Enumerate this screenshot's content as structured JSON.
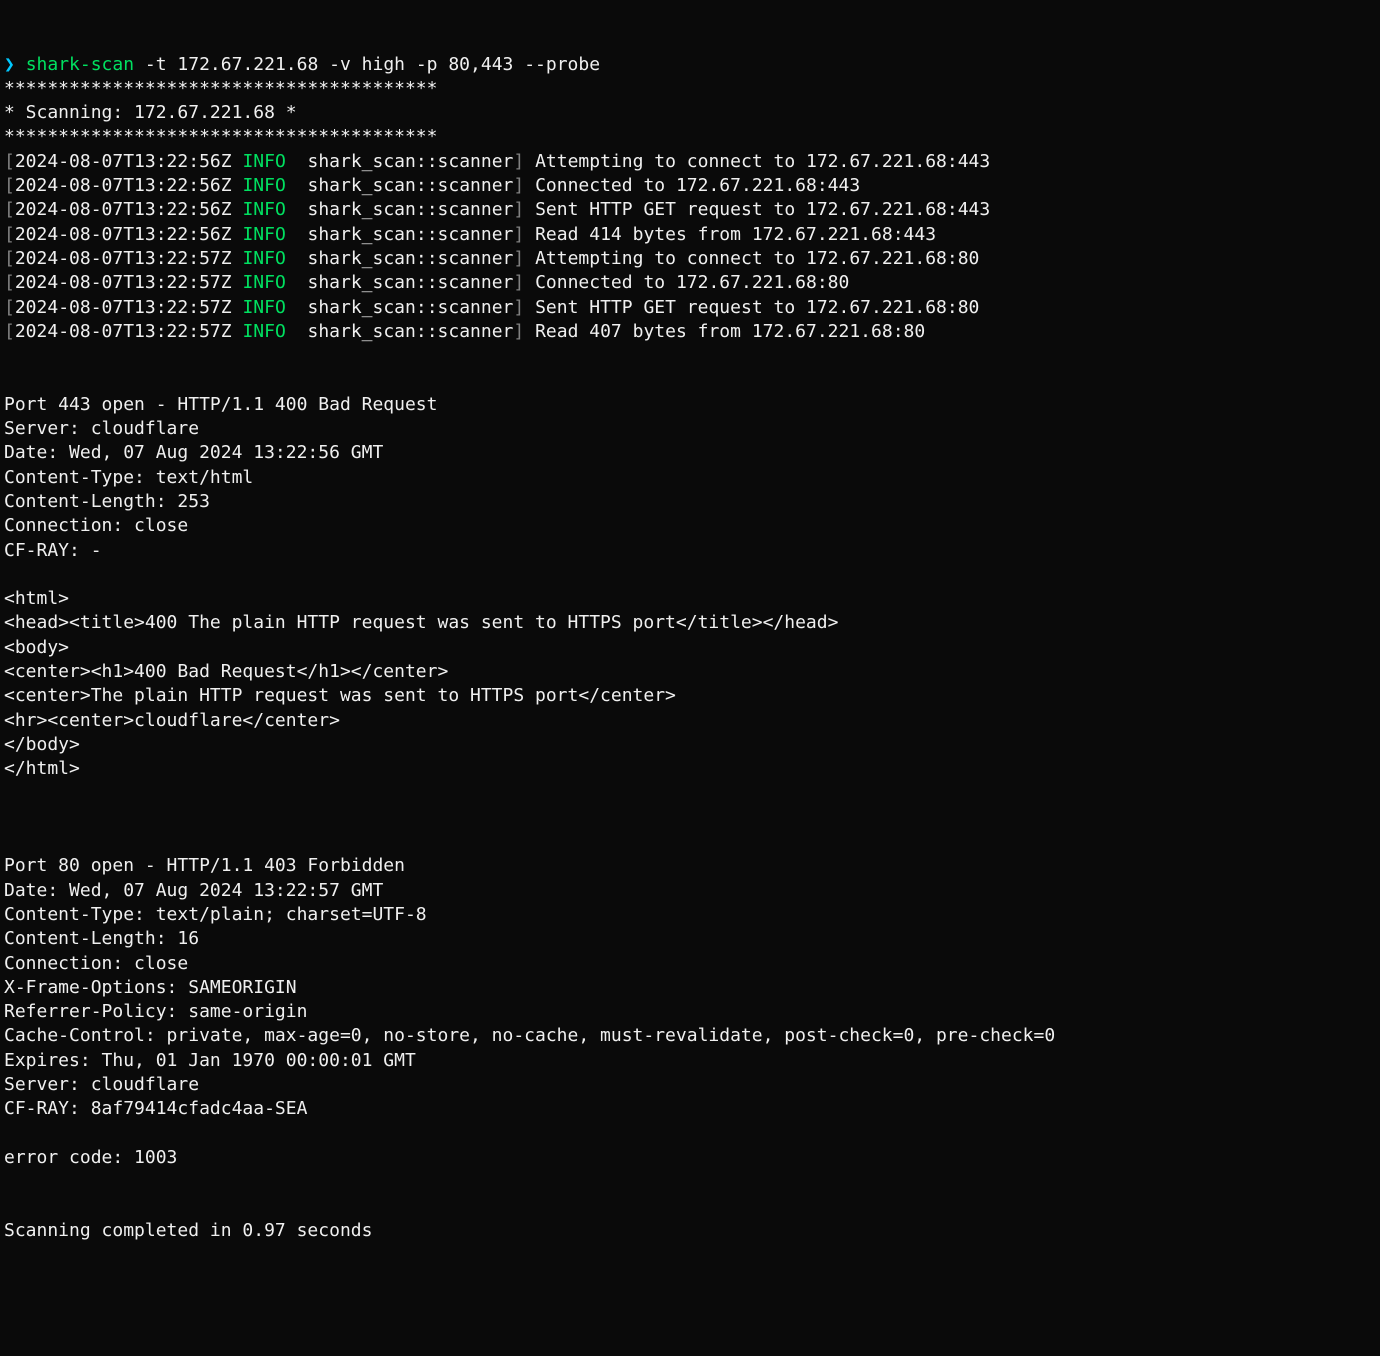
{
  "prompt": {
    "indicator": "❯",
    "cmd": "shark-scan",
    "args": "-t 172.67.221.68 -v high -p 80,443 --probe"
  },
  "banner": {
    "border": "****************************************",
    "title": "* Scanning: 172.67.221.68 *"
  },
  "logs": [
    {
      "ts": "2024-08-07T13:22:56Z",
      "level": "INFO",
      "module": "shark_scan::scanner",
      "msg": "Attempting to connect to 172.67.221.68:443"
    },
    {
      "ts": "2024-08-07T13:22:56Z",
      "level": "INFO",
      "module": "shark_scan::scanner",
      "msg": "Connected to 172.67.221.68:443"
    },
    {
      "ts": "2024-08-07T13:22:56Z",
      "level": "INFO",
      "module": "shark_scan::scanner",
      "msg": "Sent HTTP GET request to 172.67.221.68:443"
    },
    {
      "ts": "2024-08-07T13:22:56Z",
      "level": "INFO",
      "module": "shark_scan::scanner",
      "msg": "Read 414 bytes from 172.67.221.68:443"
    },
    {
      "ts": "2024-08-07T13:22:57Z",
      "level": "INFO",
      "module": "shark_scan::scanner",
      "msg": "Attempting to connect to 172.67.221.68:80"
    },
    {
      "ts": "2024-08-07T13:22:57Z",
      "level": "INFO",
      "module": "shark_scan::scanner",
      "msg": "Connected to 172.67.221.68:80"
    },
    {
      "ts": "2024-08-07T13:22:57Z",
      "level": "INFO",
      "module": "shark_scan::scanner",
      "msg": "Sent HTTP GET request to 172.67.221.68:80"
    },
    {
      "ts": "2024-08-07T13:22:57Z",
      "level": "INFO",
      "module": "shark_scan::scanner",
      "msg": "Read 407 bytes from 172.67.221.68:80"
    }
  ],
  "results443": [
    "Port 443 open - HTTP/1.1 400 Bad Request",
    "Server: cloudflare",
    "Date: Wed, 07 Aug 2024 13:22:56 GMT",
    "Content-Type: text/html",
    "Content-Length: 253",
    "Connection: close",
    "CF-RAY: -",
    "",
    "<html>",
    "<head><title>400 The plain HTTP request was sent to HTTPS port</title></head>",
    "<body>",
    "<center><h1>400 Bad Request</h1></center>",
    "<center>The plain HTTP request was sent to HTTPS port</center>",
    "<hr><center>cloudflare</center>",
    "</body>",
    "</html>"
  ],
  "results80": [
    "Port 80 open - HTTP/1.1 403 Forbidden",
    "Date: Wed, 07 Aug 2024 13:22:57 GMT",
    "Content-Type: text/plain; charset=UTF-8",
    "Content-Length: 16",
    "Connection: close",
    "X-Frame-Options: SAMEORIGIN",
    "Referrer-Policy: same-origin",
    "Cache-Control: private, max-age=0, no-store, no-cache, must-revalidate, post-check=0, pre-check=0",
    "Expires: Thu, 01 Jan 1970 00:00:01 GMT",
    "Server: cloudflare",
    "CF-RAY: 8af79414cfadc4aa-SEA",
    "",
    "error code: 1003"
  ],
  "footer": "Scanning completed in 0.97 seconds"
}
